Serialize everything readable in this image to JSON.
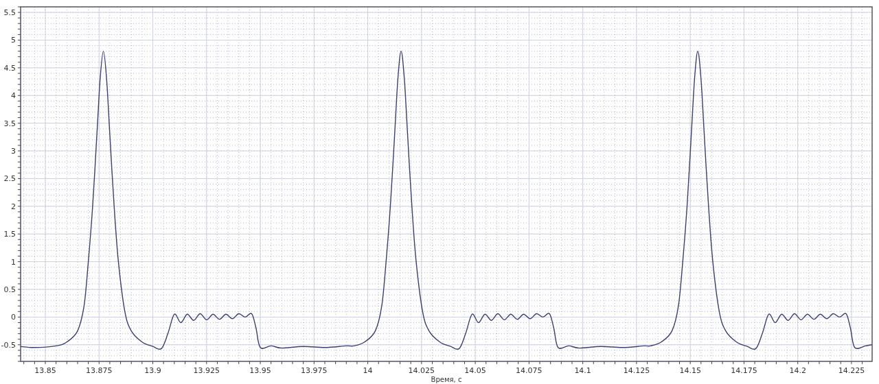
{
  "chart_data": {
    "type": "line",
    "grid": true,
    "xlabel": "Время, с",
    "xlim": [
      13.8385,
      14.2346
    ],
    "ylim": [
      -0.8,
      5.6
    ],
    "xticks": [
      13.85,
      13.875,
      13.9,
      13.925,
      13.95,
      13.975,
      14,
      14.025,
      14.05,
      14.075,
      14.1,
      14.125,
      14.15,
      14.175,
      14.2,
      14.225
    ],
    "yticks": [
      -0.5,
      0,
      0.5,
      1,
      1.5,
      2,
      2.5,
      3,
      3.5,
      4,
      4.5,
      5,
      5.5
    ],
    "x": [
      13.8385,
      13.845,
      13.855,
      13.86,
      13.865,
      13.868,
      13.87,
      13.872,
      13.874,
      13.8755,
      13.877,
      13.8785,
      13.88,
      13.882,
      13.884,
      13.887,
      13.89,
      13.895,
      13.9,
      13.904,
      13.907,
      13.91,
      13.913,
      13.916,
      13.919,
      13.922,
      13.925,
      13.928,
      13.931,
      13.934,
      13.937,
      13.94,
      13.943,
      13.946,
      13.948,
      13.95,
      13.955,
      13.96,
      13.97,
      13.98,
      13.99,
      13.9935,
      13.9985,
      14.0035,
      14.0065,
      14.0085,
      14.0105,
      14.0125,
      14.014,
      14.0155,
      14.017,
      14.0185,
      14.0205,
      14.0225,
      14.0255,
      14.0285,
      14.0335,
      14.0385,
      14.0425,
      14.0455,
      14.0485,
      14.0515,
      14.0545,
      14.0575,
      14.0605,
      14.0635,
      14.0665,
      14.0695,
      14.0725,
      14.0755,
      14.0785,
      14.0815,
      14.0845,
      14.0865,
      14.0885,
      14.0935,
      14.0985,
      14.1085,
      14.1185,
      14.1285,
      14.1315,
      14.1365,
      14.1415,
      14.1445,
      14.1465,
      14.1485,
      14.1505,
      14.152,
      14.1535,
      14.155,
      14.1565,
      14.1585,
      14.1605,
      14.1635,
      14.1665,
      14.1715,
      14.1765,
      14.1805,
      14.1835,
      14.1865,
      14.1895,
      14.1925,
      14.1955,
      14.1985,
      14.2015,
      14.2045,
      14.2075,
      14.2105,
      14.2135,
      14.2165,
      14.2195,
      14.2225,
      14.2245,
      14.2265,
      14.2315,
      14.2346
    ],
    "series": [
      {
        "color": "#3a3f72",
        "values": [
          -0.53,
          -0.55,
          -0.52,
          -0.45,
          -0.25,
          0.2,
          1.0,
          2.0,
          3.3,
          4.3,
          4.8,
          4.3,
          3.3,
          2.0,
          1.0,
          0.1,
          -0.25,
          -0.45,
          -0.53,
          -0.57,
          -0.3,
          0.05,
          -0.1,
          0.05,
          -0.06,
          0.06,
          -0.05,
          0.05,
          -0.04,
          0.05,
          -0.03,
          0.06,
          0.0,
          0.06,
          -0.2,
          -0.55,
          -0.52,
          -0.56,
          -0.53,
          -0.55,
          -0.52,
          -0.52,
          -0.45,
          -0.25,
          0.2,
          1.0,
          2.0,
          3.3,
          4.3,
          4.8,
          4.3,
          3.3,
          2.0,
          1.0,
          0.1,
          -0.25,
          -0.45,
          -0.53,
          -0.57,
          -0.3,
          0.05,
          -0.1,
          0.05,
          -0.06,
          0.06,
          -0.05,
          0.05,
          -0.04,
          0.05,
          -0.03,
          0.06,
          0.0,
          0.06,
          -0.2,
          -0.55,
          -0.52,
          -0.56,
          -0.53,
          -0.55,
          -0.52,
          -0.52,
          -0.45,
          -0.25,
          0.2,
          1.0,
          2.0,
          3.3,
          4.3,
          4.8,
          4.3,
          3.3,
          2.0,
          1.0,
          0.1,
          -0.25,
          -0.45,
          -0.53,
          -0.57,
          -0.3,
          0.05,
          -0.1,
          0.05,
          -0.06,
          0.06,
          -0.05,
          0.05,
          -0.04,
          0.05,
          -0.03,
          0.06,
          0.0,
          0.06,
          -0.2,
          -0.55,
          -0.52,
          -0.5
        ]
      }
    ]
  }
}
